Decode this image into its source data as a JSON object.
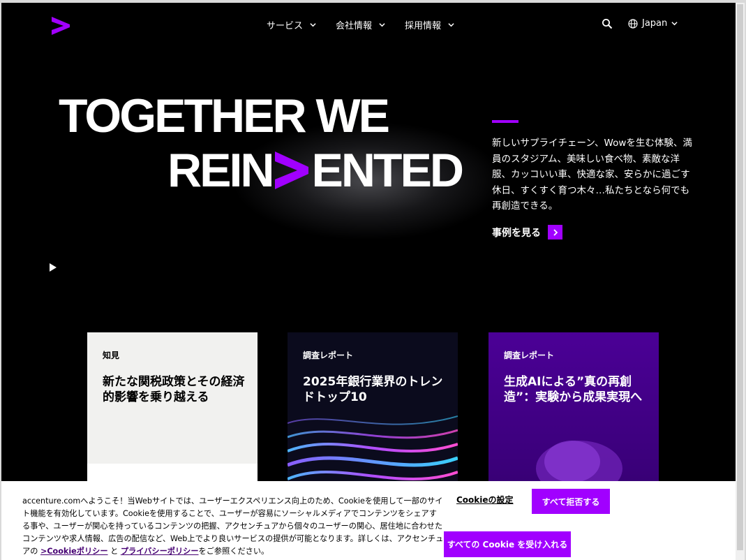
{
  "brand": {
    "logo_icon": "accenture-greater-than-logo",
    "accent_color": "#a100ff"
  },
  "nav": {
    "items": [
      {
        "label": "サービス"
      },
      {
        "label": "会社情報"
      },
      {
        "label": "採用情報"
      }
    ],
    "language": "Japan"
  },
  "hero": {
    "line1": "TOGETHER WE",
    "line2_prefix": "REIN",
    "line2_suffix": "ENTED",
    "description": "新しいサプライチェーン、Wowを生む体験、満員のスタジアム、美味しい食べ物、素敵な洋服、カッコいい車、快適な家、安らかに過ごす休日、すくすく育つ木々…私たちとなら何でも再創造できる。",
    "cta": "事例を見る"
  },
  "cards": [
    {
      "tag": "知見",
      "title": "新たな関税政策とその経済的影響を乗り越える"
    },
    {
      "tag": "調査レポート",
      "title": "2025年銀行業界のトレンドトップ10"
    },
    {
      "tag": "調査レポート",
      "title": "生成AIによる”真の再創造”：実験から成果実現へ"
    }
  ],
  "cookie": {
    "text_before": "accenture.comへようこそ！当Webサイトでは、ユーザーエクスペリエンス向上のため、Cookieを使用して一部のサイト機能を有効化しています。Cookieを使用することで、ユーザーが容易にソーシャルメディアでコンテンツをシェアする事や、ユーザーが関心を持っているコンテンツの把握、アクセンチュアから個々のユーザーの関心、居住地に合わせたコンテンツや求人情報、広告の配信など、Web上でより良いサービスの提供が可能となります。詳しくは、アクセンチュアの",
    "link1": ">Cookieポリシー",
    "and": "と",
    "link2": "プライバシーポリシー",
    "text_after": "をご参照ください。",
    "settings": "Cookieの設定",
    "reject_all": "すべて拒否する",
    "accept_all": "すべての Cookie を受け入れる"
  }
}
